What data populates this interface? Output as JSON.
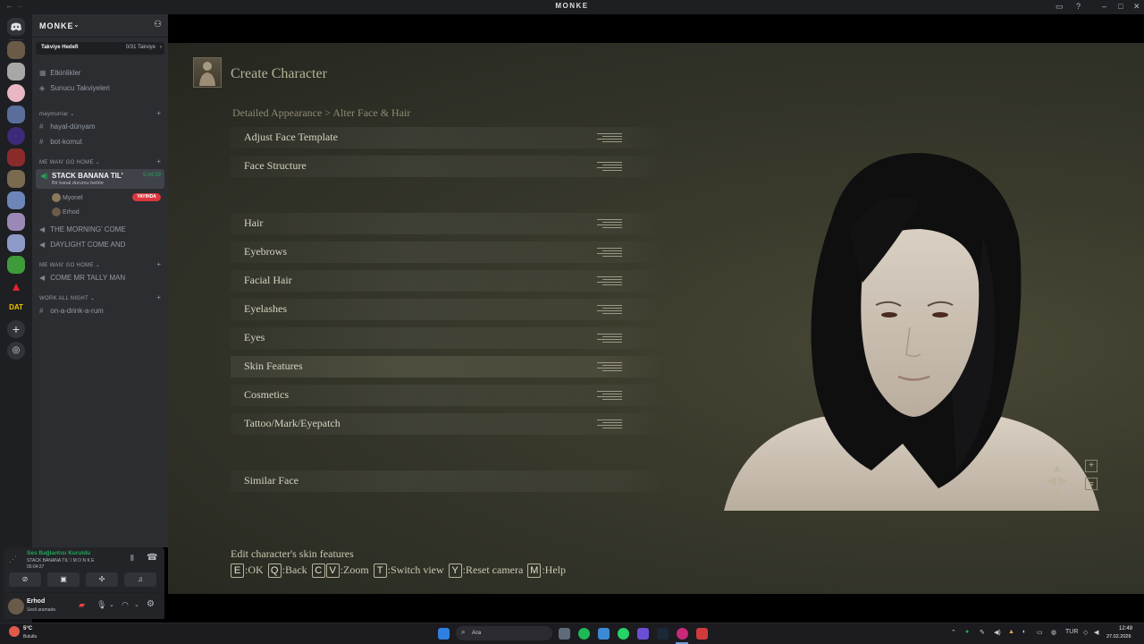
{
  "window": {
    "title": "MONKE",
    "back_arrow": "←",
    "forward_arrow": "→"
  },
  "server": {
    "name": "MONKE",
    "boost_goal_label": "Takviye Hedefi",
    "boost_goal_value": "0/31 Takviye",
    "top_items": [
      "Etkinlikler",
      "Sunucu Takviyeleri"
    ],
    "categories": [
      {
        "name": "maymunlar",
        "channels": [
          {
            "type": "text",
            "name": "hayal-dünyam"
          },
          {
            "type": "text",
            "name": "bot-komut"
          }
        ]
      },
      {
        "name": "ME WAN' GO HOME",
        "channels": [
          {
            "type": "voice",
            "name": "STACK BANANA TIL'",
            "status": "Bir kanal durumu belirle",
            "timer": "5:04:59",
            "users": [
              {
                "name": "Myonel",
                "badge": "YAYINDA"
              },
              {
                "name": "Erhod"
              }
            ]
          },
          {
            "type": "voice",
            "name": "THE MORNING' COME"
          },
          {
            "type": "voice",
            "name": "DAYLIGHT COME AND"
          }
        ]
      },
      {
        "name": "ME WAN' GO HOME",
        "channels": [
          {
            "type": "voice",
            "name": "COME MR TALLY MAN"
          }
        ]
      },
      {
        "name": "WORK ALL NIGHT",
        "channels": [
          {
            "type": "text",
            "name": "on-a-drink-a-rum"
          }
        ]
      }
    ]
  },
  "voice_panel": {
    "status": "Ses Bağlantısı Kuruldu",
    "channel": "STACK BANANA TIL' / M O N K E",
    "timer": "05:04:27"
  },
  "user": {
    "name": "Erhod",
    "status": "Sesli aramada"
  },
  "game": {
    "title": "Create Character",
    "breadcrumb": "Detailed Appearance > Alter Face & Hair",
    "menu_items": [
      {
        "label": "Adjust Face Template"
      },
      {
        "label": "Face Structure"
      },
      {
        "label": "Hair"
      },
      {
        "label": "Eyebrows"
      },
      {
        "label": "Facial Hair"
      },
      {
        "label": "Eyelashes"
      },
      {
        "label": "Eyes"
      },
      {
        "label": "Skin Features",
        "selected": true
      },
      {
        "label": "Cosmetics"
      },
      {
        "label": "Tattoo/Mark/Eyepatch"
      },
      {
        "label": "Similar Face"
      }
    ],
    "description": "Edit character's skin features",
    "controls": [
      {
        "keys": [
          "E"
        ],
        "label": ":OK"
      },
      {
        "keys": [
          "Q"
        ],
        "label": ":Back"
      },
      {
        "keys": [
          "C",
          "V"
        ],
        "label": ":Zoom"
      },
      {
        "keys": [
          "T"
        ],
        "label": ":Switch view"
      },
      {
        "keys": [
          "Y"
        ],
        "label": ":Reset camera"
      },
      {
        "keys": [
          "M"
        ],
        "label": ":Help"
      }
    ]
  },
  "taskbar": {
    "weather_temp": "5°C",
    "weather_desc": "Bulutlu",
    "search_placeholder": "Ara",
    "language": "TUR",
    "time": "12:49",
    "date": "27.02.2026"
  }
}
